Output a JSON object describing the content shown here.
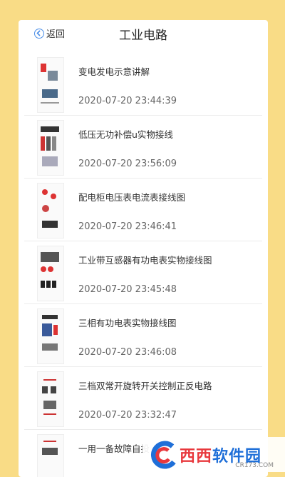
{
  "header": {
    "back_label": "返回",
    "title": "工业电路"
  },
  "items": [
    {
      "title": "变电发电示意讲解",
      "time": "2020-07-20 23:44:39"
    },
    {
      "title": "低压无功补偿u实物接线",
      "time": "2020-07-20 23:56:09"
    },
    {
      "title": "配电柜电压表电流表接线图",
      "time": "2020-07-20 23:46:41"
    },
    {
      "title": "工业带互感器有功电表实物接线图",
      "time": "2020-07-20 23:45:48"
    },
    {
      "title": "三相有功电表实物接线图",
      "time": "2020-07-20 23:46:08"
    },
    {
      "title": "三档双常开旋转开关控制正反电路",
      "time": "2020-07-20 23:32:47"
    },
    {
      "title": "一用一备故障自投",
      "time": ""
    }
  ],
  "watermark": {
    "brand_a": "西西",
    "brand_b": "软件园",
    "domain": "CR173.COM"
  },
  "colors": {
    "background": "#f9dc86",
    "accent": "#4a8ee8",
    "watermark_red": "#e8383d",
    "watermark_blue": "#1f6fd8"
  }
}
